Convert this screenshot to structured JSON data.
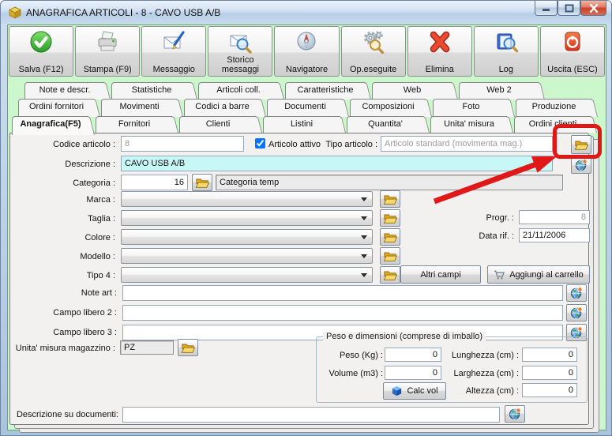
{
  "window": {
    "title": "ANAGRAFICA ARTICOLI - 8 - CAVO USB A/B",
    "controls": {
      "minimize": "minimize",
      "maximize": "maximize",
      "close": "close"
    }
  },
  "toolbar": {
    "buttons": [
      {
        "label": "Salva (F12)",
        "icon": "green-check"
      },
      {
        "label": "Stampa (F9)",
        "icon": "printer"
      },
      {
        "label": "Messaggio",
        "icon": "envelope-pen"
      },
      {
        "label": "Storico messaggi",
        "icon": "envelope-magnifier"
      },
      {
        "label": "Navigatore",
        "icon": "compass"
      },
      {
        "label": "Op.eseguite",
        "icon": "gears-magnifier"
      },
      {
        "label": "Elimina",
        "icon": "red-x"
      },
      {
        "label": "Log",
        "icon": "book-magnifier"
      },
      {
        "label": "Uscita (ESC)",
        "icon": "power"
      }
    ]
  },
  "tabs": {
    "row1": [
      "Note e descr.",
      "Statistiche",
      "Articoli coll.",
      "Caratteristiche",
      "Web",
      "Web 2"
    ],
    "row2": [
      "Ordini fornitori",
      "Movimenti",
      "Codici a barre",
      "Documenti",
      "Composizioni",
      "Foto",
      "Produzione"
    ],
    "row3": [
      "Anagrafica(F5)",
      "Fornitori",
      "Clienti",
      "Listini",
      "Quantita'",
      "Unita' misura",
      "Ordini clienti"
    ],
    "active": "Anagrafica(F5)"
  },
  "form": {
    "codice_articolo": {
      "label": "Codice articolo :",
      "value": "8"
    },
    "articolo_attivo_label": "Articolo attivo",
    "articolo_attivo_checked": true,
    "tipo_articolo": {
      "label": "Tipo articolo :",
      "value": "Articolo standard (movimenta mag.)"
    },
    "descrizione": {
      "label": "Descrizione :",
      "value": "CAVO USB A/B"
    },
    "categoria": {
      "label": "Categoria :",
      "code": "16",
      "name": "Categoria temp"
    },
    "dropdowns": [
      {
        "label": "Marca :",
        "value": ""
      },
      {
        "label": "Taglia :",
        "value": ""
      },
      {
        "label": "Colore :",
        "value": ""
      },
      {
        "label": "Modello :",
        "value": ""
      },
      {
        "label": "Tipo 4 :",
        "value": ""
      }
    ],
    "progr": {
      "label": "Progr. :",
      "value": "8"
    },
    "data_rif": {
      "label": "Data rif. :",
      "value": "21/11/2006"
    },
    "altri_campi_label": "Altri campi",
    "aggiungi_carrello_label": "Aggiungi al carrello",
    "note_art": {
      "label": "Note art :",
      "value": ""
    },
    "campo_libero_2": {
      "label": "Campo libero 2 :",
      "value": ""
    },
    "campo_libero_3": {
      "label": "Campo libero 3 :",
      "value": ""
    },
    "unita_misura_magazzino": {
      "label": "Unita' misura magazzino :",
      "value": "PZ"
    },
    "peso_gruppo": {
      "title": "Peso e dimensioni (comprese di imballo)",
      "peso": {
        "label": "Peso (Kg) :",
        "value": "0"
      },
      "volume": {
        "label": "Volume (m3) :",
        "value": "0"
      },
      "lunghezza": {
        "label": "Lunghezza (cm) :",
        "value": "0"
      },
      "larghezza": {
        "label": "Larghezza (cm) :",
        "value": "0"
      },
      "altezza": {
        "label": "Altezza (cm) :",
        "value": "0"
      },
      "calc_vol_label": "Calc vol"
    },
    "descrizione_documenti": {
      "label": "Descrizione su documenti:",
      "value": ""
    }
  },
  "annotations": {
    "highlight_color": "#e01818",
    "highlight_target": "tipo-articolo-folder-button"
  },
  "colors": {
    "content_bg": "#ccf6cb",
    "descrizione_bg": "#c8f7f7",
    "panel_bg": "#f2f1f0"
  }
}
